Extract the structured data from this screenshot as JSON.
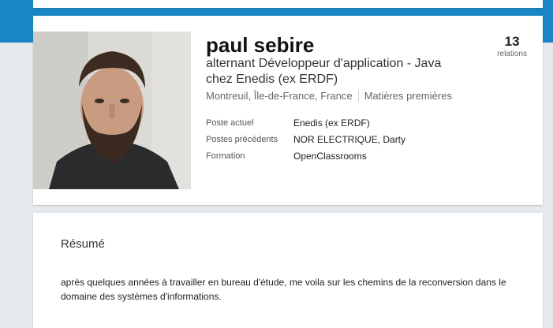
{
  "profile": {
    "name": "paul sebire",
    "headline": "alternant Développeur d'application - Java chez Enedis (ex ERDF)",
    "location": "Montreuil, Île-de-France, France",
    "industry": "Matières premières",
    "connections": {
      "count": "13",
      "label": "relations"
    },
    "details": [
      {
        "key": "Poste actuel",
        "value": "Enedis (ex ERDF)"
      },
      {
        "key": "Postes précédents",
        "value": "NOR ELECTRIQUE, Darty"
      },
      {
        "key": "Formation",
        "value": "OpenClassrooms"
      }
    ]
  },
  "summary": {
    "title": "Résumé",
    "text": "après quelques années à travailler en bureau d'étude, me voila sur les chemins de la reconversion dans le domaine des systèmes d'informations."
  },
  "colors": {
    "header_blue": "#1b86c6",
    "page_background": "#e6e9ec",
    "card_background": "#ffffff"
  }
}
